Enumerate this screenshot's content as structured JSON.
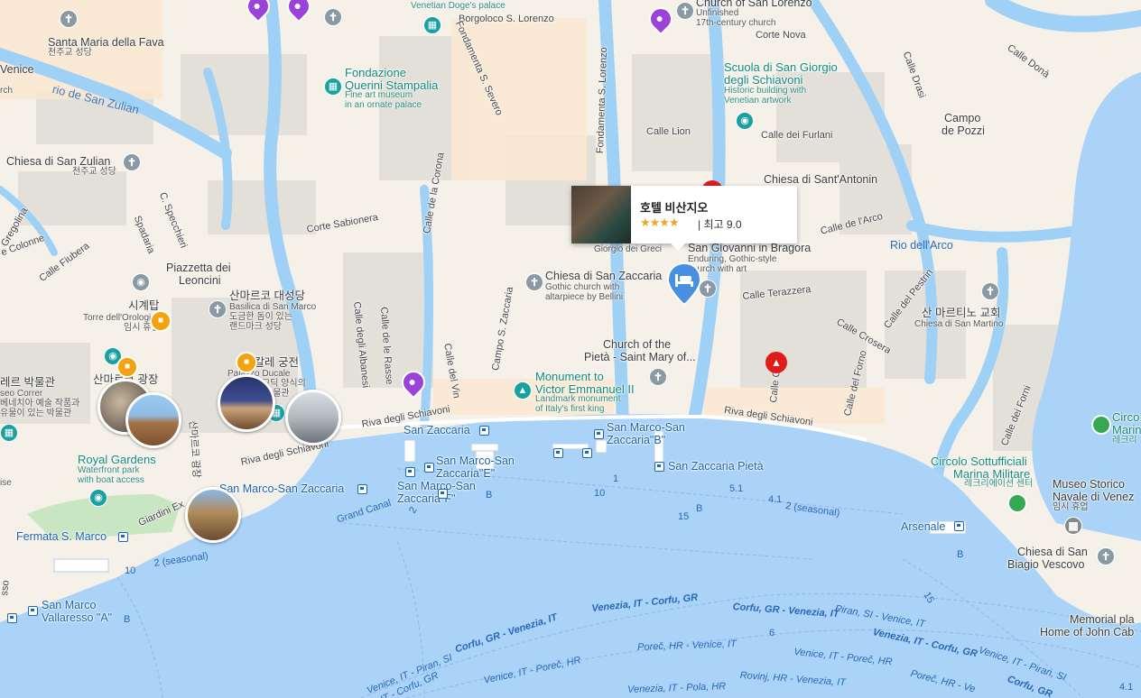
{
  "map": {
    "labels": {
      "santa_maria_fava": "Santa Maria della Fava",
      "santa_maria_fava_ko": "천주교 성당",
      "venice": "Venice",
      "rch": "rch",
      "rio_san_zulian": "rio de San Zulian",
      "chiesa_san_zulian": "Chiesa di San Zulian",
      "chiesa_san_zulian_ko": "천주교 성당",
      "fondazione": "Fondazione",
      "querini": "Querini Stampalia",
      "querini_sub1": "Fine art museum",
      "querini_sub2": "in an ornate palace",
      "doge_palace_top": "Venetian Doge's palace",
      "borgoloco": "Borgoloco S. Lorenzo",
      "fondamenta_severo": "Fondamenta S. Severo",
      "fondamenta_lorenzo": "Fondamenta S. Lorenzo",
      "church_san_lorenzo": "Church of San Lorenzo",
      "unfinished1": "Unfinished",
      "unfinished2": "17th-century church",
      "corte_nova": "Corte Nova",
      "calle_drasi": "Calle Drasi",
      "calle_dona": "Calle Donà",
      "scuola1": "Scuola di San Giorgio",
      "scuola2": "degli Schiavoni",
      "scuola_sub1": "Historic building with",
      "scuola_sub2": "Venetian artwork",
      "calle_lion": "Calle Lion",
      "calle_furlani": "Calle dei Furlani",
      "campo_pozzi1": "Campo",
      "campo_pozzi2": "de Pozzi",
      "chiesa_antonin": "Chiesa di Sant'Antonin",
      "calle_arco": "Calle de l'Arco",
      "rio_arco": "Rio dell'Arco",
      "gregolina": "Gregolina",
      "colonne": "e Colonne",
      "calle_fiubera": "Calle Fiubera",
      "specchieri": "C. Specchieri",
      "spadaria": "Spadaria",
      "corte_sabionera": "Corte Sabionera",
      "calle_corona": "Calle de la Corona",
      "piazzetta1": "Piazzetta dei",
      "piazzetta2": "Leoncini",
      "sigyetap": "시계탑",
      "torre": "Torre dell'Orologio",
      "torre_ko": "임시 휴업",
      "basilica_ko": "산마르코 대성당",
      "basilica_en": "Basilica di San Marco",
      "basilica_sub1": "도금한 돔이 있는",
      "basilica_sub2": "랜드마크 성당",
      "calle_albanesi": "Calle degli Albanesi",
      "calle_rasse": "Calle de le Rasse",
      "campo_zaccaria": "Campo S. Zaccaria",
      "calle_vin": "Calle del Vin",
      "chiesa_zaccaria": "Chiesa di San Zaccaria",
      "zaccaria_sub1": "Gothic church with",
      "zaccaria_sub2": "altarpiece by Bellini",
      "giorgio_greci": "Giorgio dei Greci",
      "bragora": "San Giovanni in Bragora",
      "bragora_sub1": "Enduring, Gothic-style",
      "bragora_sub2": "church with art",
      "calle_terazzera": "Calle Terazzera",
      "calle_crosera": "Calle Crosera",
      "calle_pestrin": "Calle del Pestrin",
      "san_martino_ko": "산 마르티노 교회",
      "san_martino": "Chiesa di San Martino",
      "calle_forno": "Calle del Forno",
      "calle_close": "Calle Close",
      "pieta1": "Church of the",
      "pieta2": "Pietà - Saint Mary of...",
      "monument1": "Monument to",
      "monument2": "Victor Emmanuel II",
      "monument_sub1": "Landmark monument",
      "monument_sub2": "of Italy's first king",
      "riva_schiavoni": "Riva degli Schiavoni",
      "riva_schiavoni_left": "Riva degli Schiavoni",
      "riva_schiavoni_right": "Riva degli Schiavoni",
      "museo_correr_ko": "레르 박물관",
      "museo_correr": "seo Correr",
      "correr_sub1": "베네치아 예술 작품과",
      "correr_sub2": "유물이 있는 박물관",
      "piazza_ko": "산마르코 광장",
      "palazzo_ko": "두칼레 궁전",
      "palazzo": "Palazzo Ducale",
      "palazzo_sub1": "고딕 양식의",
      "palazzo_sub2": "박물관",
      "sanmarco_road_ko": "산마르코 광장",
      "royal_gardens": "Royal Gardens",
      "royal_sub1": "Waterfront park",
      "royal_sub2": "with boat access",
      "giardini": "Giardini Ex",
      "ise": "ise",
      "grand_canal": "Grand Canal",
      "calle_forni": "Calle dei Forni",
      "circolo1": "Circolo Sottufficiali",
      "circolo2": "Marina Militare",
      "circolo_ko": "레크리에이션 센터",
      "circo_r1": "Circo",
      "circo_r2": "Marin",
      "circo_r3": "레크리",
      "museo_storico1": "Museo Storico",
      "museo_storico2": "Navale di Venez",
      "museo_storico_ko": "임시 휴업",
      "arsenale": "Arsenale",
      "chiesa_biagio1": "Chiesa di San",
      "chiesa_biagio2": "Biagio Vescovo",
      "memorial1": "Memorial pla",
      "memorial2": "Home of John Cab",
      "sso": "sso"
    },
    "stops": {
      "san_zaccaria": "San Zaccaria",
      "smz_b1": "San Marco-San",
      "smz_b2": "Zaccaria\"B\"",
      "smz_e1": "San Marco-San",
      "smz_e2": "Zaccaria\"E\"",
      "smz_f1": "San Marco-San",
      "smz_f2": "Zaccaria\"F\"",
      "zaccaria_pieta": "San Zaccaria Pietà",
      "smz": "San Marco-San Zaccaria",
      "fermata": "Fermata S. Marco",
      "vallaresso1": "San Marco",
      "vallaresso2": "Vallaresso \"A\""
    },
    "routes": {
      "r1": "1",
      "r10": "10",
      "rB": "B",
      "r15": "15",
      "r51": "5.1",
      "r41": "4.1",
      "r2seas": "2 (seasonal)",
      "r2": "2",
      "r10b": "10",
      "r2seas_b": "2 (seasonal)",
      "rB2": "B",
      "rB3": "B",
      "r15b": "15",
      "r6": "6",
      "r41b": "4.1",
      "rB4": "B",
      "venezia_corfu": "Venezia, IT - Corfu, GR",
      "corfu_venezia": "Corfu, GR - Venezia, IT",
      "piran_venice": "Piran, SI - Venice, IT",
      "venezia_corfu2": "Venezia, IT - Corfu, GR",
      "corfu_venezia2": "Corfu, GR - Venezia, IT",
      "venice_piran": "Venice, IT - Piran, SI",
      "venice_porec": "Venice, IT - Poreč, HR",
      "porec_venice": "Poreč, HR - Venice, IT",
      "venice_porec2": "Venice, IT - Poreč, HR",
      "venezia_pola": "Venezia, IT - Pola, HR",
      "rovinj": "Rovinj, HR - Venezia, IT",
      "porec_ve": "Poreč, HR - Ve",
      "it_corfu": "IT - Corfu, GR",
      "venice_piran_left": "Venice, IT - Piran, SI",
      "venice_piran_right": "Venice, IT - Piran, SI",
      "corfu_gr": "Corfu, GR"
    },
    "hotel_popup": {
      "name": "호텔 비산지오",
      "stars": "★★★★",
      "star_count": 4,
      "rating": "| 최고 9.0"
    },
    "colors": {
      "water": "#aad3f7",
      "canal": "#9fd0f5",
      "land": "#f5f1e8",
      "building": "#e4e1dc",
      "hotel_pin": "#4a90e2",
      "purple_pin": "#9b43d9",
      "teal": "#128a7a"
    }
  }
}
